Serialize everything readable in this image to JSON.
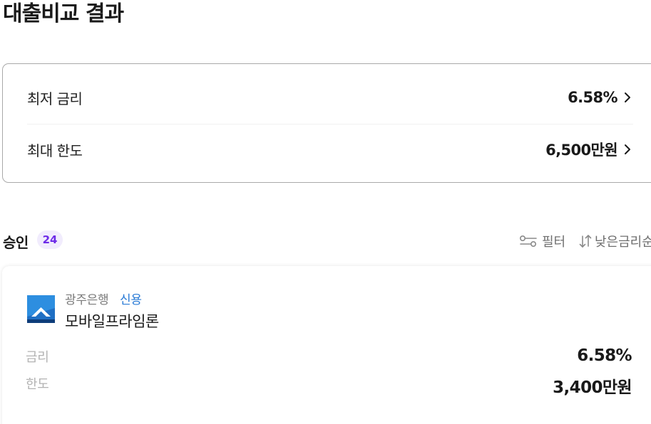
{
  "header": {
    "title": "대출비교 결과"
  },
  "summary": {
    "lowest_rate_label": "최저 금리",
    "lowest_rate_value": "6.58%",
    "max_limit_label": "최대 한도",
    "max_limit_value": "6,500만원"
  },
  "approved": {
    "title": "승인",
    "count": "24",
    "filter_label": "필터",
    "sort_label": "낮은금리순",
    "filter_icon": "filter-sliders-icon",
    "sort_icon": "sort-arrows-icon"
  },
  "loans": [
    {
      "bank_name": "광주은행",
      "loan_type": "신용",
      "product_name": "모바일프라임론",
      "rate_label": "금리",
      "rate_value": "6.58%",
      "limit_label": "한도",
      "limit_value": "3,400만원",
      "logo_icon": "kwangju-bank-logo"
    }
  ],
  "colors": {
    "accent_purple": "#6d2ae8",
    "badge_bg": "#f1ecfd",
    "loan_type_blue": "#2a7bd6",
    "muted_label": "#b3b3b3"
  }
}
